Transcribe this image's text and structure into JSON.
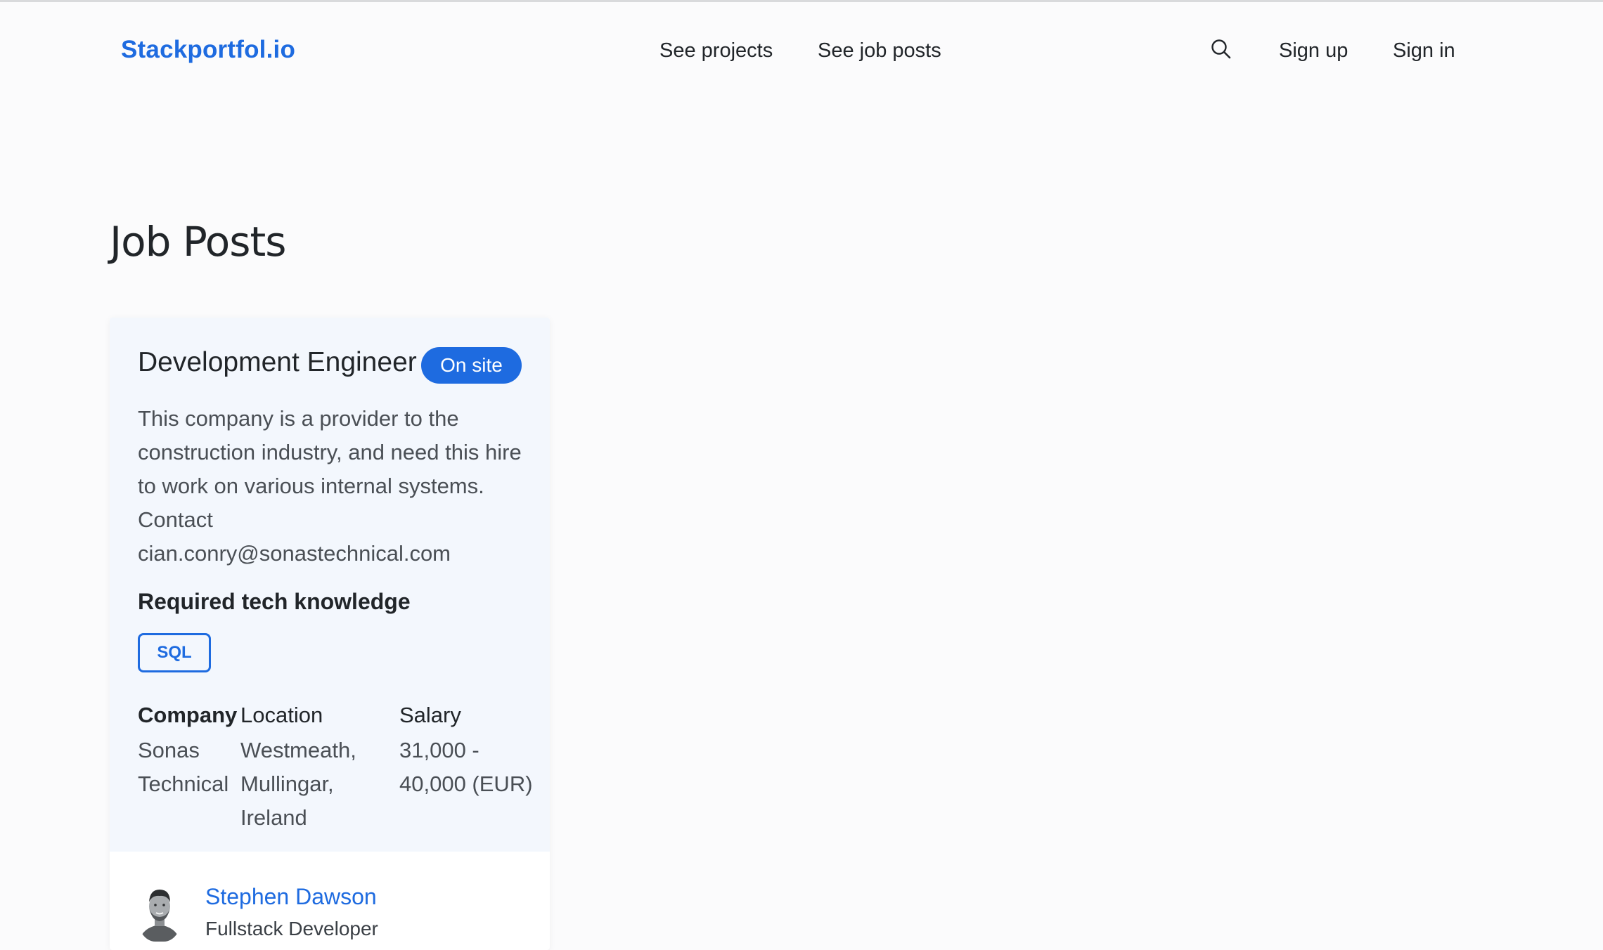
{
  "navbar": {
    "brand": "Stackportfol.io",
    "links": {
      "projects": "See projects",
      "job_posts": "See job posts"
    },
    "search_icon": "search-icon",
    "sign_up": "Sign up",
    "sign_in": "Sign in"
  },
  "page": {
    "title": "Job Posts"
  },
  "job_post": {
    "title": "Development Engineer",
    "badge": "On site",
    "description": "This company is a provider to the construction industry, and need this hire to work on various internal systems. Contact cian.conry@sonastechnical.com",
    "tech_heading": "Required tech knowledge",
    "tech": [
      "SQL"
    ],
    "info": {
      "company_label": "Company",
      "location_label": "Location",
      "salary_label": "Salary",
      "company": "Sonas Technical",
      "location": "Westmeath, Mullingar, Ireland",
      "salary": "31,000 - 40,000 (EUR)"
    },
    "author": {
      "name": "Stephen Dawson",
      "role": "Fullstack Developer"
    }
  },
  "colors": {
    "accent": "#1e6be0",
    "card_body": "#f3f7fd",
    "background": "#fbfbfc"
  }
}
